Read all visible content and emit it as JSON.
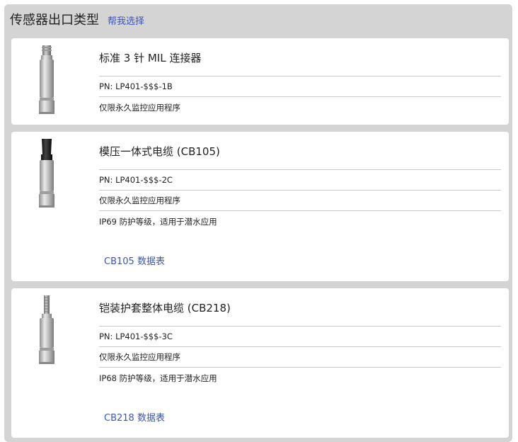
{
  "header": {
    "title": "传感器出口类型",
    "help_link": "帮我选择"
  },
  "cards": [
    {
      "name": "标准 3 针 MIL 连接器",
      "pn": "PN: LP401-$$$-1B",
      "rows": [
        "仅限永久监控应用程序"
      ],
      "image": "mil-connector-sensor-icon"
    },
    {
      "name": "模压一体式电缆 (CB105)",
      "pn": "PN: LP401-$$$-2C",
      "rows": [
        "仅限永久监控应用程序",
        "IP69 防护等级，适用于潜水应用"
      ],
      "datasheet_link": "CB105 数据表",
      "image": "molded-cable-sensor-icon"
    },
    {
      "name": "铠装护套整体电缆 (CB218)",
      "pn": "PN: LP401-$$$-3C",
      "rows": [
        "仅限永久监控应用程序",
        "IP68 防护等级，适用于潜水应用"
      ],
      "datasheet_link": "CB218 数据表",
      "image": "armored-cable-sensor-icon"
    }
  ],
  "colors": {
    "panel": "#d4d4d4",
    "card": "#ffffff",
    "link": "#3c55b5",
    "divider": "#c9c9c9"
  }
}
